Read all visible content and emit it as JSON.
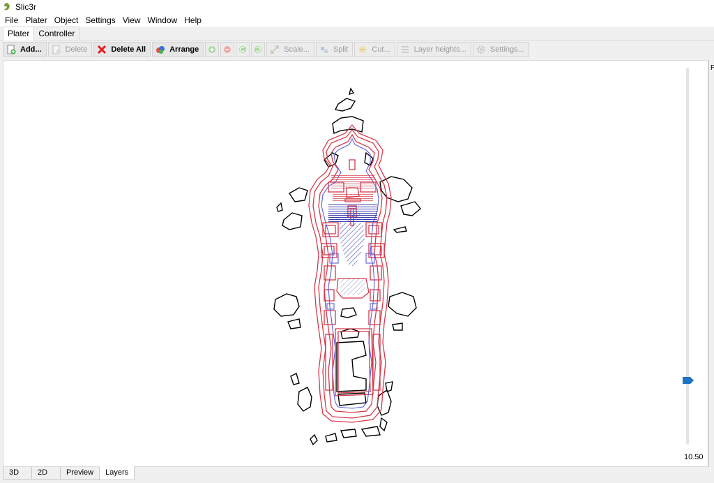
{
  "window": {
    "title": "Slic3r"
  },
  "menu": [
    "File",
    "Plater",
    "Object",
    "Settings",
    "View",
    "Window",
    "Help"
  ],
  "tabs": [
    {
      "label": "Plater",
      "active": true
    },
    {
      "label": "Controller",
      "active": false
    }
  ],
  "toolbar": {
    "add": "Add...",
    "delete": "Delete",
    "delete_all": "Delete All",
    "arrange": "Arrange",
    "scale": "Scale...",
    "split": "Split",
    "cut": "Cut...",
    "layer_heights": "Layer heights...",
    "settings": "Settings..."
  },
  "layer_slider": {
    "value": "10.50",
    "fraction": 0.17
  },
  "right_edge_letter": "P",
  "bottom_tabs": [
    {
      "label": "3D",
      "active": false
    },
    {
      "label": "2D",
      "active": false
    },
    {
      "label": "Preview",
      "active": false
    },
    {
      "label": "Layers",
      "active": true
    }
  ],
  "colors": {
    "perimeter": "#d4394a",
    "inner_perimeter": "#5a5fd6",
    "infill": "#3a3fb0",
    "outline": "#000000",
    "slider_thumb": "#1f73c4"
  }
}
